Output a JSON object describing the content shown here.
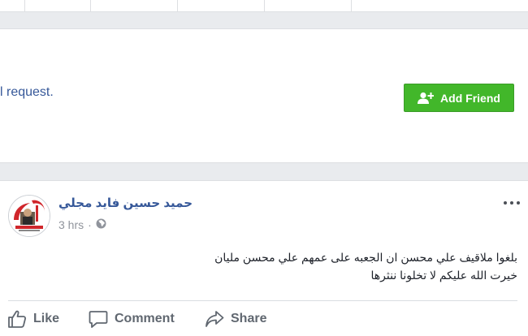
{
  "request": {
    "text_fragment": "l request.",
    "add_friend_label": "Add Friend"
  },
  "post": {
    "author_name": "حميد حسين فايد مجلي",
    "timestamp": "3 hrs",
    "privacy_icon": "globe-icon",
    "body_lines": [
      "بلغوا ملاقيف علي محسن ان الجعبه على عمهم علي محسن مليان",
      "خيرت الله عليكم لا تخلونا ننثرها"
    ],
    "actions": {
      "like": "Like",
      "comment": "Comment",
      "share": "Share"
    }
  },
  "colors": {
    "accent_green": "#42b72a",
    "link_blue": "#365899",
    "page_bg": "#e9ebee"
  }
}
